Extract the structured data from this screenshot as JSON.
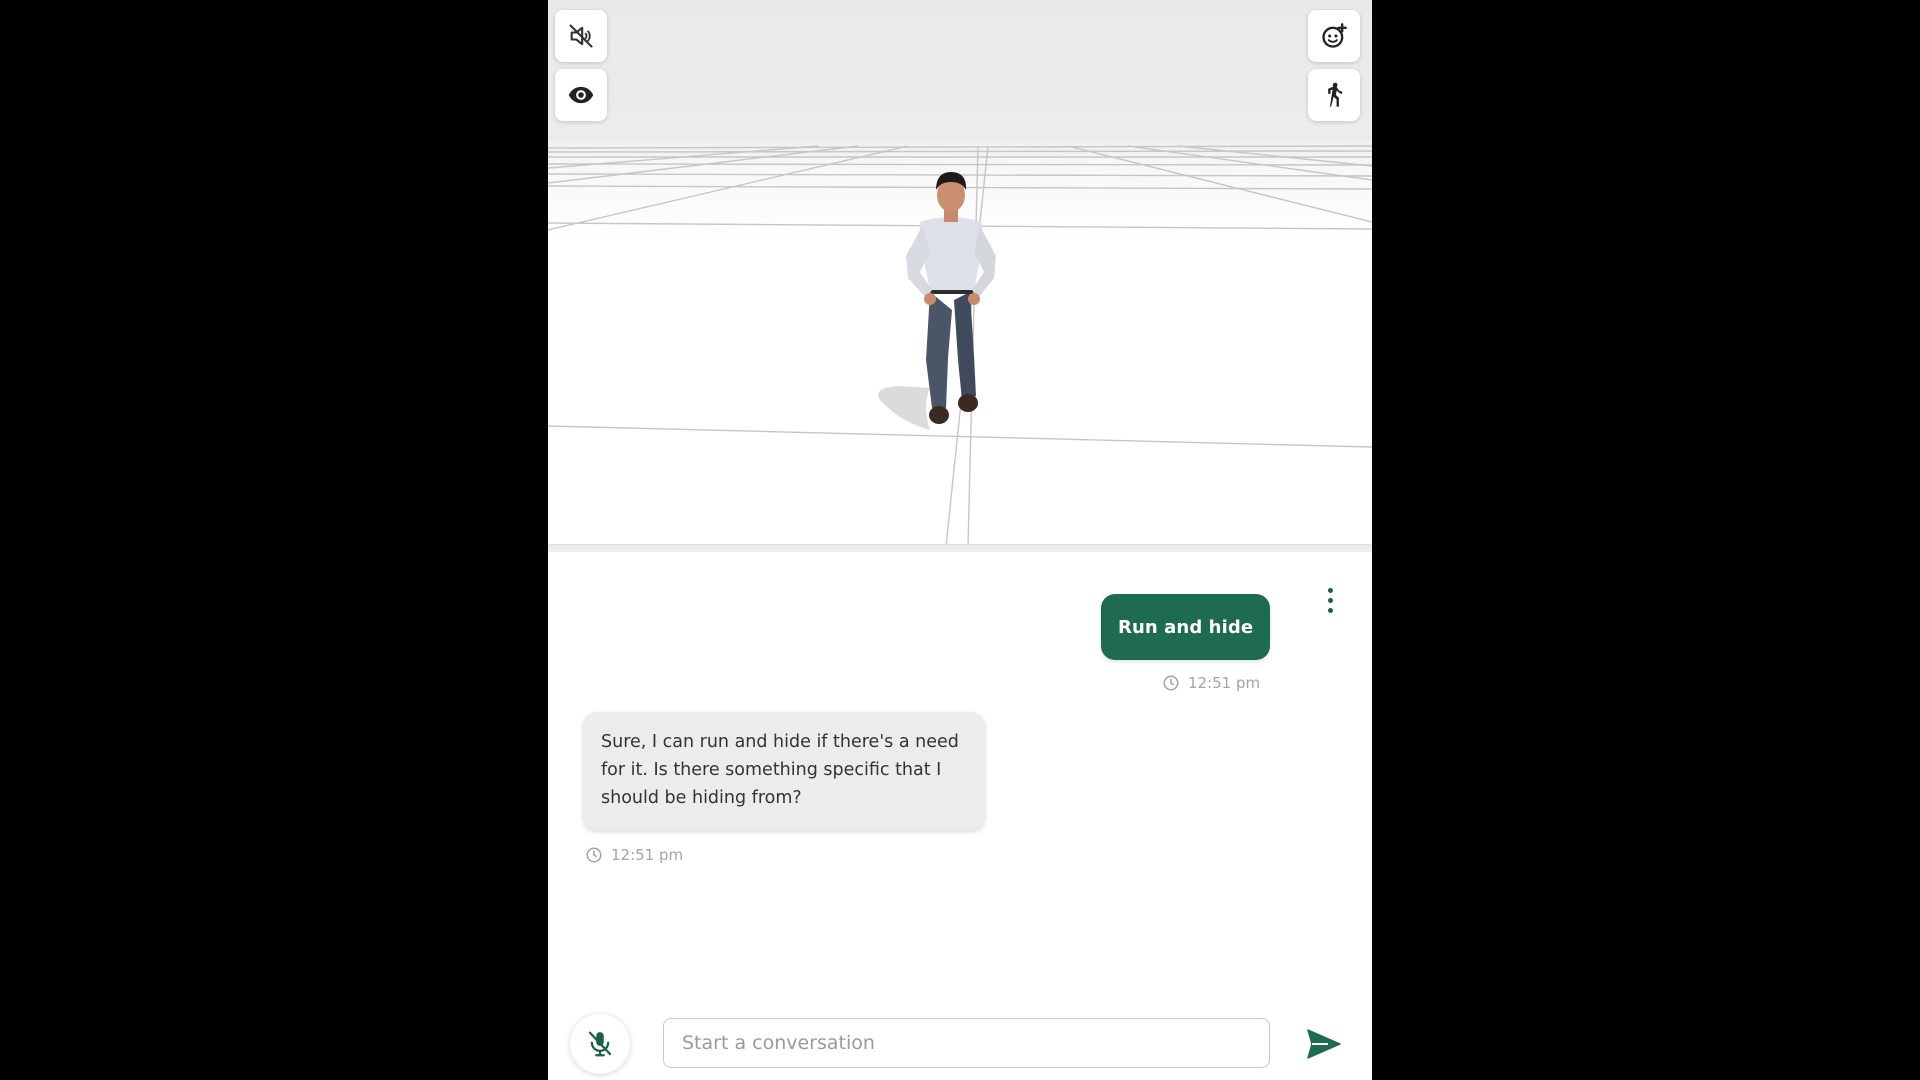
{
  "toolbar": {
    "mute_icon": "speaker-muted-icon",
    "visibility_icon": "eye-icon",
    "emotion_icon": "face-add-icon",
    "animation_icon": "walking-person-icon"
  },
  "chat": {
    "messages": [
      {
        "role": "user",
        "text": "Run and hide",
        "time": "12:51 pm"
      },
      {
        "role": "assistant",
        "text": "Sure, I can run and hide if there's a need for it. Is there something specific that I should be hiding from?",
        "time": "12:51 pm"
      }
    ]
  },
  "composer": {
    "placeholder": "Start a conversation",
    "value": "",
    "mic_icon": "mic-off-icon",
    "send_icon": "send-icon"
  },
  "colors": {
    "accent": "#1f6b4f",
    "assistant_bubble": "#ececec",
    "page_background": "#000000"
  }
}
